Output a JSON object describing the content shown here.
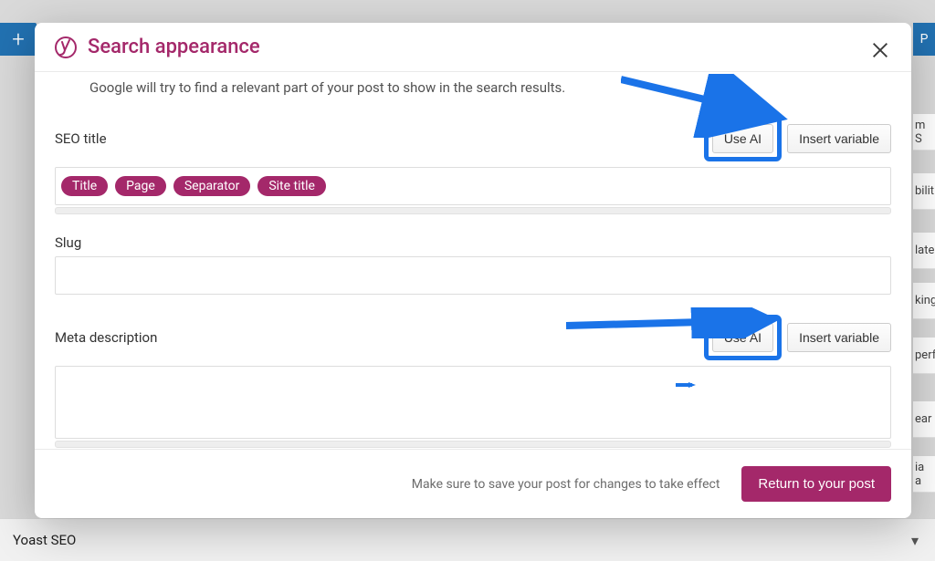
{
  "behind": {
    "plus_icon": "+",
    "publish_fragment": "P",
    "side_fragments": [
      "m S",
      "bilit",
      "late",
      "king",
      "perf",
      "ear",
      "ia a"
    ],
    "bottom_panel": "Yoast SEO"
  },
  "modal": {
    "title": "Search appearance",
    "hint": "Google will try to find a relevant part of your post to show in the search results.",
    "seo_title": {
      "label": "SEO title",
      "use_ai": "Use AI",
      "insert_variable": "Insert variable",
      "variables": [
        "Title",
        "Page",
        "Separator",
        "Site title"
      ]
    },
    "slug": {
      "label": "Slug",
      "value": ""
    },
    "meta": {
      "label": "Meta description",
      "use_ai": "Use AI",
      "insert_variable": "Insert variable",
      "value": ""
    },
    "footer_hint": "Make sure to save your post for changes to take effect",
    "return_button": "Return to your post"
  }
}
